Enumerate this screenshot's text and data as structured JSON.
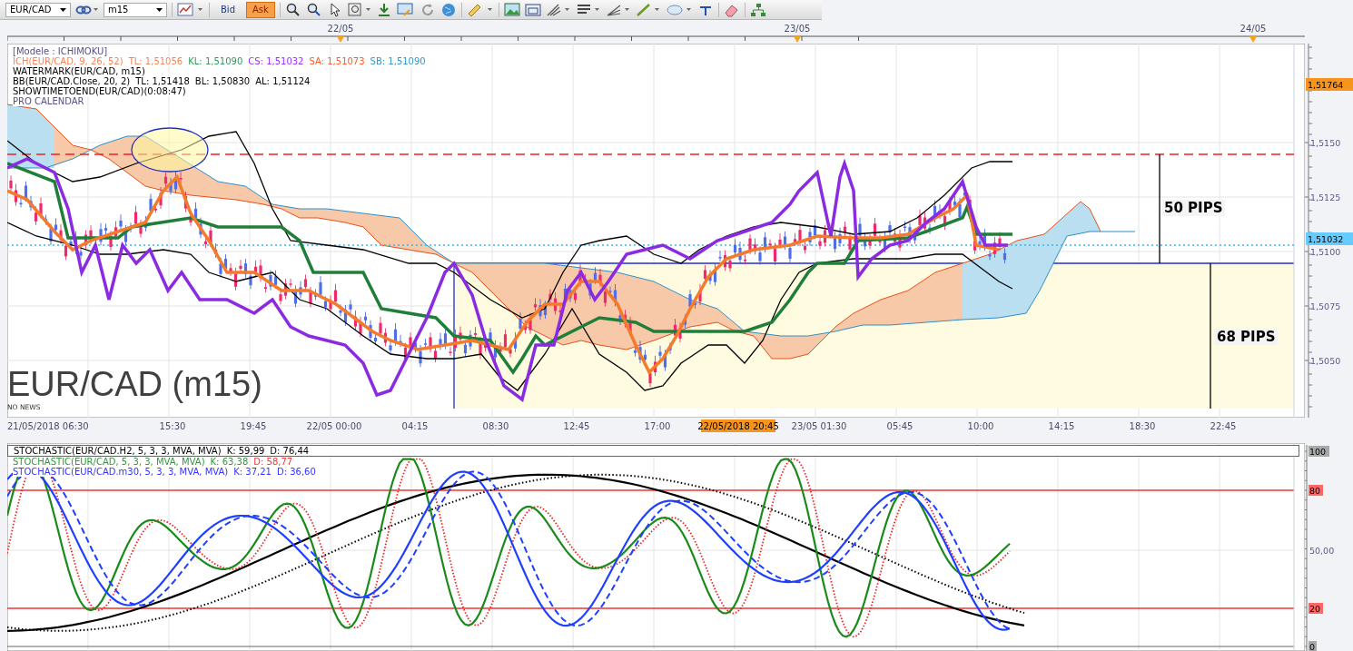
{
  "toolbar": {
    "symbol": "EUR/CAD",
    "timeframe": "m15",
    "quote_buttons": [
      {
        "label": "Bid",
        "selected": false
      },
      {
        "label": "Ask",
        "selected": true
      }
    ]
  },
  "date_markers": [
    "22/05",
    "23/05",
    "24/05"
  ],
  "legend": [
    [
      {
        "text": "[Modele : ICHIMOKU]",
        "color": "#5b4b8a"
      }
    ],
    [
      {
        "text": "ICH(EUR/CAD, 9, 26, 52)",
        "color": "#f5845a"
      },
      {
        "text": "TL: 1,51056",
        "color": "#f5845a"
      },
      {
        "text": "KL: 1,51090",
        "color": "#2e9a5a"
      },
      {
        "text": "CS: 1,51032",
        "color": "#9b30ff"
      },
      {
        "text": "SA: 1,51073",
        "color": "#ff5a1f"
      },
      {
        "text": "SB: 1,51090",
        "color": "#3399cc"
      }
    ],
    [
      {
        "text": "WATERMARK(EUR/CAD, m15)",
        "color": "#000000"
      }
    ],
    [
      {
        "text": "BB(EUR/CAD.Close, 20, 2)",
        "color": "#000000"
      },
      {
        "text": "TL: 1,51418",
        "color": "#000000"
      },
      {
        "text": "BL: 1,50830",
        "color": "#000000"
      },
      {
        "text": "AL: 1,51124",
        "color": "#000000"
      }
    ],
    [
      {
        "text": "SHOWTIMETOEND(EUR/CAD)(0:08:47)",
        "color": "#000000"
      }
    ],
    [
      {
        "text": "PRO CALENDAR",
        "color": "#5b4b8a"
      }
    ]
  ],
  "watermark": "EUR/CAD (m15)",
  "news_label": "NO NEWS",
  "pip_labels": [
    "50 PIPS",
    "68 PIPS"
  ],
  "price_axis": {
    "ticks": [
      "1,5150",
      "1,5125",
      "1,5100",
      "1,5075",
      "1,5050"
    ],
    "markers": [
      {
        "label": "1,51764",
        "color": "#f7941d"
      },
      {
        "label": "1,51032",
        "color": "#66ccff"
      }
    ]
  },
  "time_axis": [
    {
      "label": "21/05/2018 06:30",
      "current": false
    },
    {
      "label": "15:30",
      "current": false
    },
    {
      "label": "19:45",
      "current": false
    },
    {
      "label": "22/05 00:00",
      "current": false
    },
    {
      "label": "04:15",
      "current": false
    },
    {
      "label": "08:30",
      "current": false
    },
    {
      "label": "12:45",
      "current": false
    },
    {
      "label": "17:00",
      "current": false
    },
    {
      "label": "22/05/2018 20:45",
      "current": true
    },
    {
      "label": "23/05 01:30",
      "current": false
    },
    {
      "label": "05:45",
      "current": false
    },
    {
      "label": "10:00",
      "current": false
    },
    {
      "label": "14:15",
      "current": false
    },
    {
      "label": "18:30",
      "current": false
    },
    {
      "label": "22:45",
      "current": false
    }
  ],
  "stochastic": {
    "legend": [
      [
        {
          "text": "STOCHASTIC(EUR/CAD.H2, 5, 3, 3, MVA, MVA)",
          "color": "#000000"
        },
        {
          "text": "K: 59,99",
          "color": "#000000"
        },
        {
          "text": "D: 76,44",
          "color": "#000000"
        }
      ],
      [
        {
          "text": "STOCHASTIC(EUR/CAD, 5, 3, 3, MVA, MVA)",
          "color": "#2e9a3a"
        },
        {
          "text": "K: 63,38",
          "color": "#2e9a3a"
        },
        {
          "text": "D: 58,77",
          "color": "#ff3333"
        }
      ],
      [
        {
          "text": "STOCHASTIC(EUR/CAD.m30, 5, 3, 3, MVA, MVA)",
          "color": "#3333ff"
        },
        {
          "text": "K: 37,21",
          "color": "#3333ff"
        },
        {
          "text": "D: 36,60",
          "color": "#3333ff"
        }
      ]
    ],
    "axis": [
      {
        "label": "100",
        "kind": "bound"
      },
      {
        "label": "80",
        "kind": "level"
      },
      {
        "label": "50,00",
        "kind": "mid"
      },
      {
        "label": "20",
        "kind": "level"
      },
      {
        "label": "0",
        "kind": "bound"
      }
    ]
  }
}
